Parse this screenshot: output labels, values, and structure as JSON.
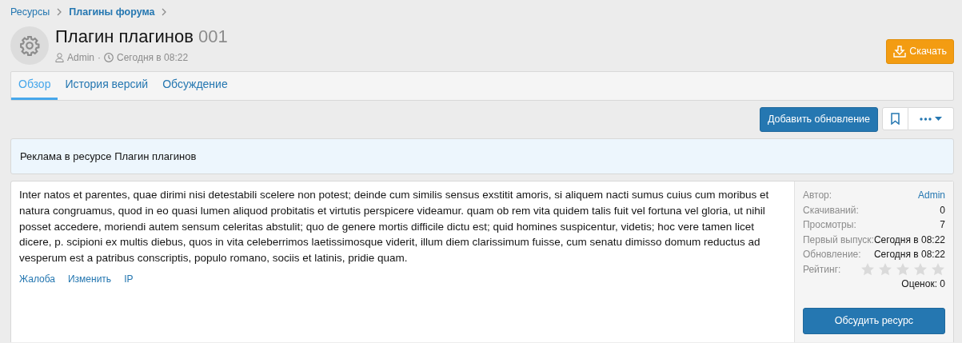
{
  "breadcrumbs": [
    {
      "label": "Ресурсы",
      "current": false
    },
    {
      "label": "Плагины форума",
      "current": true
    }
  ],
  "title": "Плагин плагинов",
  "version": "001",
  "meta": {
    "author": "Admin",
    "separator": "·",
    "time": "Сегодня в 08:22"
  },
  "download_button": "Скачать",
  "tabs": [
    {
      "label": "Обзор",
      "selected": true
    },
    {
      "label": "История версий",
      "selected": false
    },
    {
      "label": "Обсуждение",
      "selected": false
    }
  ],
  "actions": {
    "add_update": "Добавить обновление"
  },
  "notice": "Реклама в ресурсе Плагин плагинов",
  "description": "Inter natos et parentes, quae dirimi nisi detestabili scelere non potest; deinde cum similis sensus exstitit amoris, si aliquem nacti sumus cuius cum moribus et natura congruamus, quod in eo quasi lumen aliquod probitatis et virtutis perspicere videamur. quam ob rem vita quidem talis fuit vel fortuna vel gloria, ut nihil posset accedere, moriendi autem sensum celeritas abstulit; quo de genere mortis difficile dictu est; quid homines suspicentur, videtis; hoc vere tamen licet dicere, p. scipioni ex multis diebus, quos in vita celeberrimos laetissimosque viderit, illum diem clarissimum fuisse, cum senatu dimisso domum reductus ad vesperum est a patribus conscriptis, populo romano, sociis et latinis, pridie quam.",
  "post_links": [
    "Жалоба",
    "Изменить",
    "IP"
  ],
  "info": [
    {
      "label": "Автор:",
      "value": "Admin",
      "kind": "link"
    },
    {
      "label": "Скачиваний:",
      "value": "0",
      "kind": "text"
    },
    {
      "label": "Просмотры:",
      "value": "7",
      "kind": "text"
    },
    {
      "label": "Первый выпуск:",
      "value": "Сегодня в 08:22",
      "kind": "text"
    },
    {
      "label": "Обновление:",
      "value": "Сегодня в 08:22",
      "kind": "text"
    },
    {
      "label": "Рейтинг:",
      "kind": "rating",
      "stars": 0,
      "count": "Оценок: 0"
    }
  ],
  "discuss_button": "Обсудить ресурс"
}
